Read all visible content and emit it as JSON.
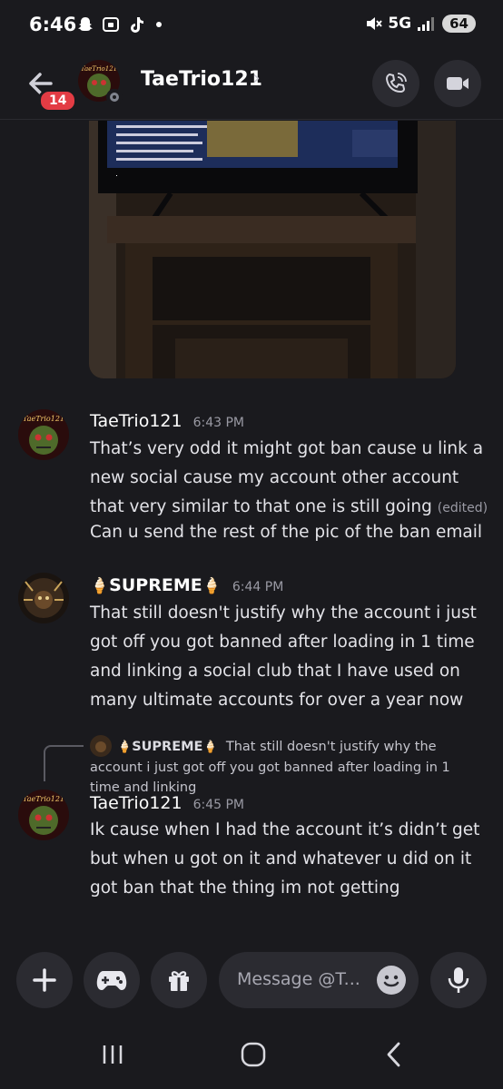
{
  "status_bar": {
    "time": "6:46",
    "network": "5G",
    "battery": "64",
    "icons": [
      "snapchat-icon",
      "screenshot-icon",
      "tiktok-icon",
      "notification-dot-icon",
      "mute-icon",
      "signal-icon"
    ]
  },
  "header": {
    "unread_count": "14",
    "contact_name": "TaeTrio121",
    "avatar_text": "TaeTrio121"
  },
  "messages": [
    {
      "author": "TaeTrio121",
      "time": "6:43 PM",
      "avatar_text": "TaeTrio121",
      "lines": [
        "That’s very odd it might got ban cause u link a new social cause my account other account that very similar to that one is still going",
        "Can u send the rest of the pic of the ban email"
      ],
      "edited_label": "(edited)"
    },
    {
      "author": "SUPREME",
      "time": "6:44 PM",
      "text": "That still doesn't justify why the account i just got off you got banned after loading in 1 time and linking a social club that I have used on many ultimate accounts for over a year now"
    },
    {
      "reply_author": "SUPREME",
      "reply_text": "That still doesn't justify why the account i just got off you got banned after loading in 1 time and linking",
      "author": "TaeTrio121",
      "time": "6:45 PM",
      "avatar_text": "TaeTrio121",
      "text": "Ik cause when I had the account it’s didn’t get but when u got on it and whatever u did on it got ban that the thing im not getting"
    }
  ],
  "input": {
    "placeholder": "Message @T..."
  },
  "colors": {
    "background": "#1a1a1e",
    "button_bg": "#2b2b31",
    "badge": "#e33c44"
  }
}
